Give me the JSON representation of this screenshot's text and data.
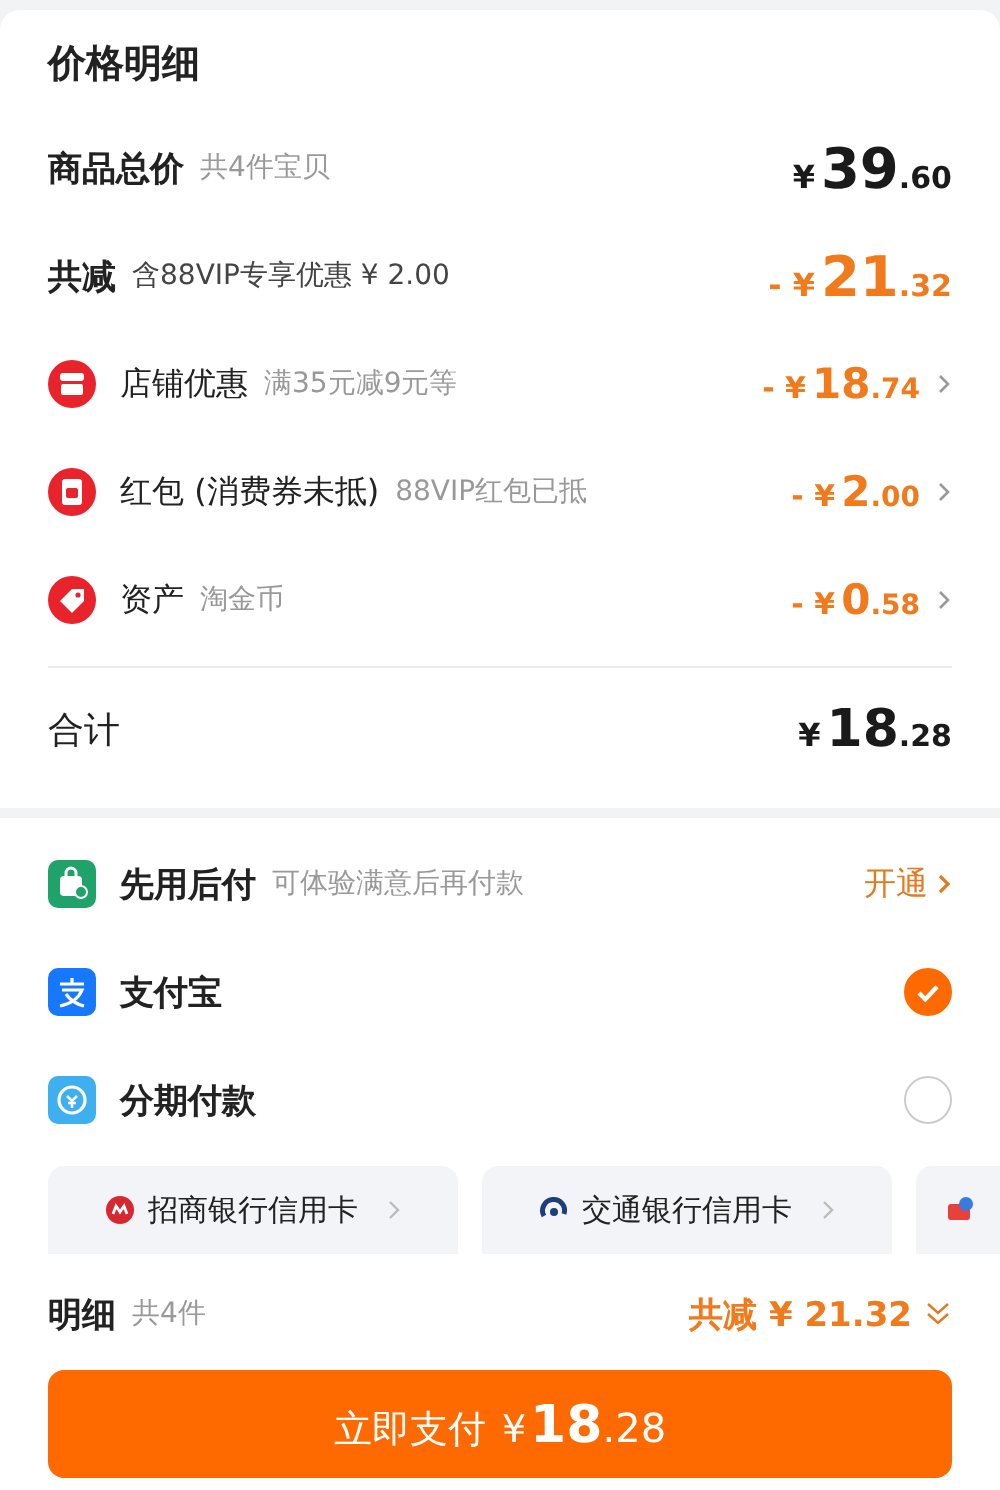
{
  "price_detail": {
    "title": "价格明细",
    "subtotal": {
      "label": "商品总价",
      "note": "共4件宝贝",
      "prefix": "¥",
      "int": "39",
      "dec": ".60"
    },
    "discount": {
      "label": "共减",
      "note": "含88VIP专享优惠 ¥ 2.00",
      "prefix": "- ¥",
      "int": "21",
      "dec": ".32"
    },
    "items": [
      {
        "kind": "shop",
        "label": "店铺优惠",
        "note": "满35元减9元等",
        "prefix": "- ¥",
        "int": "18",
        "dec": ".74"
      },
      {
        "kind": "redpacket",
        "label": "红包 (消费券未抵)",
        "note": "88VIP红包已抵",
        "prefix": "- ¥",
        "int": "2",
        "dec": ".00"
      },
      {
        "kind": "coin",
        "label": "资产",
        "note": "淘金币",
        "prefix": "- ¥",
        "int": "0",
        "dec": ".58"
      }
    ],
    "total": {
      "label": "合计",
      "prefix": "¥",
      "int": "18",
      "dec": ".28"
    }
  },
  "payment": {
    "methods": [
      {
        "kind": "paylater",
        "label": "先用后付",
        "note": "可体验满意后再付款",
        "action": "开通"
      },
      {
        "kind": "alipay",
        "label": "支付宝",
        "selected": true
      },
      {
        "kind": "installment",
        "label": "分期付款",
        "selected": false
      }
    ],
    "cards": [
      {
        "kind": "cmb",
        "label": "招商银行信用卡"
      },
      {
        "kind": "bocom",
        "label": "交通银行信用卡"
      },
      {
        "kind": "other"
      }
    ]
  },
  "footer": {
    "label": "明细",
    "count": "共4件",
    "saving": "共减 ¥ 21.32",
    "button": {
      "label": "立即支付",
      "prefix": "¥",
      "int": "18",
      "dec": ".28"
    }
  }
}
